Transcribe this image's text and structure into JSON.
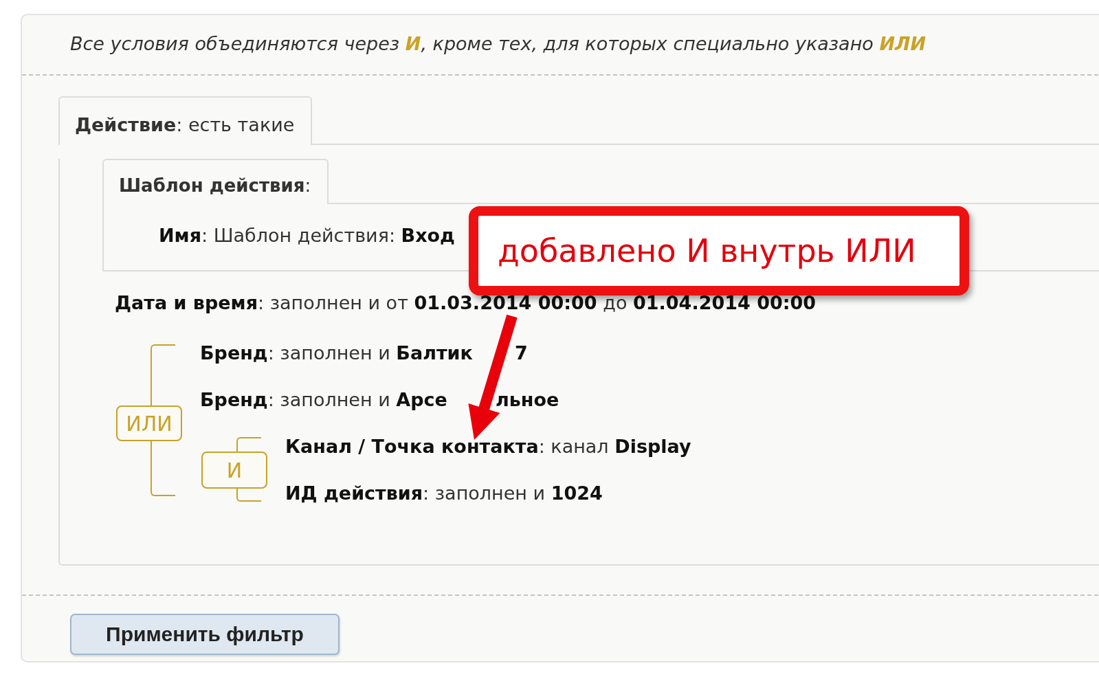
{
  "hint": "Все условия объединяются через **И**, кроме тех, для которых специально указано **ИЛИ**",
  "tab": {
    "label": "**Действие**: есть такие"
  },
  "subtab": {
    "label": "**Шаблон действия**:"
  },
  "name_row": "**Имя**: Шаблон действия: **Вход**",
  "date_row": "**Дата и время**: заполнен и от **01.03.2014 00:00** до **01.04.2014 00:00**",
  "or_group": {
    "operator": "ИЛИ",
    "items": [
      {
        "kind": "condition",
        "text": "**Бренд**: заполнен и **Балтик**",
        "text_after": "**7**"
      },
      {
        "kind": "condition",
        "text": "**Бренд**: заполнен и **Арсе**",
        "text_after": "**льное**"
      },
      {
        "kind": "group",
        "operator": "И",
        "items": [
          {
            "kind": "condition",
            "text": "**Канал / Точка контакта**: канал **Display**"
          },
          {
            "kind": "condition",
            "text": "**ИД действия**: заполнен и **1024**"
          }
        ]
      }
    ]
  },
  "apply_button": "Применить фильтр",
  "callout": {
    "text": "добавлено И внутрь ИЛИ"
  }
}
